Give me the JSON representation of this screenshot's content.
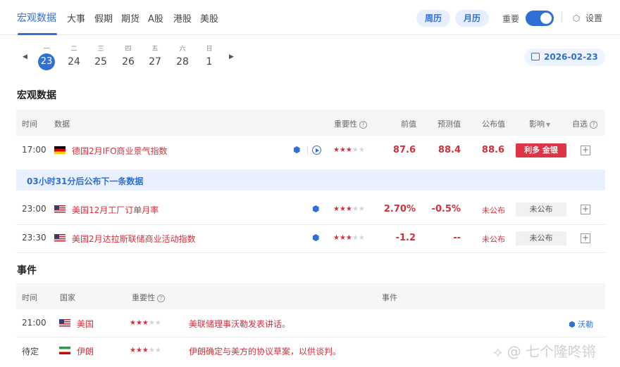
{
  "nav": {
    "tabs": [
      "宏观数据",
      "大事",
      "假期",
      "期货",
      "A股",
      "港股",
      "美股"
    ],
    "week_label": "周历",
    "month_label": "月历",
    "important_label": "重要",
    "settings_label": "设置"
  },
  "date_strip": {
    "days": [
      {
        "weekday": "一",
        "day": "23"
      },
      {
        "weekday": "二",
        "day": "24"
      },
      {
        "weekday": "三",
        "day": "25"
      },
      {
        "weekday": "四",
        "day": "26"
      },
      {
        "weekday": "五",
        "day": "27"
      },
      {
        "weekday": "六",
        "day": "28"
      },
      {
        "weekday": "日",
        "day": "1"
      }
    ],
    "selected_date": "2026-02-23"
  },
  "macro": {
    "title": "宏观数据",
    "headers": {
      "time": "时间",
      "data": "数据",
      "importance": "重要性",
      "previous": "前值",
      "forecast": "预测值",
      "actual": "公布值",
      "impact": "影响",
      "watch": "自选"
    },
    "rows": [
      {
        "time": "17:00",
        "flag": "germany-flag",
        "name": "德国2月IFO商业景气指数",
        "stars": 3,
        "previous": "87.6",
        "forecast": "88.4",
        "actual": "88.6",
        "impact": "利多 金银"
      },
      {
        "time": "23:00",
        "flag": "us-flag",
        "name": "美国12月工厂订单月率",
        "stars": 3,
        "previous": "2.70%",
        "forecast": "-0.5%",
        "actual": "未公布",
        "impact": "未公布"
      },
      {
        "time": "23:30",
        "flag": "us-flag",
        "name": "美国2月达拉斯联储商业活动指数",
        "stars": 3,
        "previous": "-1.2",
        "forecast": "--",
        "actual": "未公布",
        "impact": "未公布"
      }
    ],
    "next_notice": "03小时31分后公布下一条数据"
  },
  "events": {
    "title": "事件",
    "headers": {
      "time": "时间",
      "country": "国家",
      "importance": "重要性",
      "event": "事件"
    },
    "rows": [
      {
        "time": "21:00",
        "flag": "us-flag",
        "country": "美国",
        "stars": 3,
        "event": "美联储理事沃勒发表讲话。",
        "link": "沃勒"
      },
      {
        "time": "待定",
        "flag": "iran-flag",
        "country": "伊朗",
        "stars": 3,
        "event": "伊朗确定与美方的协议草案，以供谈判。",
        "link": ""
      }
    ]
  },
  "watermark": "七个隆咚锵",
  "colors": {
    "accent": "#2f6fd6",
    "bullish": "#dc3545",
    "text_red": "#d0313e"
  }
}
